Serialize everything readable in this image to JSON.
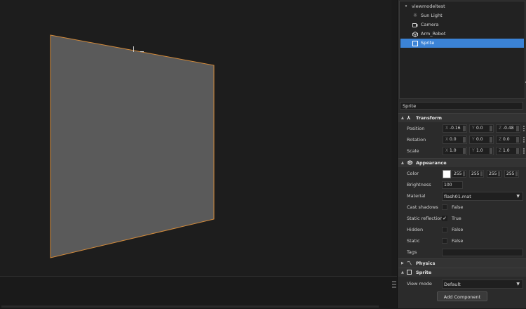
{
  "hierarchy": {
    "root": "viewmodeltest",
    "items": [
      {
        "label": "Sun Light",
        "icon": "sun-icon"
      },
      {
        "label": "Camera",
        "icon": "camera-icon"
      },
      {
        "label": "Arm_Robot",
        "icon": "model-icon"
      },
      {
        "label": "Sprite",
        "icon": "sprite-icon",
        "selected": true
      }
    ]
  },
  "object_name": "Sprite",
  "transform": {
    "title": "Transform",
    "position_label": "Position",
    "rotation_label": "Rotation",
    "scale_label": "Scale",
    "position": {
      "x": "-0.16",
      "y": "0.0",
      "z": "-0.48"
    },
    "rotation": {
      "x": "0.0",
      "y": "0.0",
      "z": "0.0"
    },
    "scale": {
      "x": "1.0",
      "y": "1.0",
      "z": "1.0"
    },
    "axis_x": "X",
    "axis_y": "Y",
    "axis_z": "Z"
  },
  "appearance": {
    "title": "Appearance",
    "color_label": "Color",
    "color_values": [
      "255",
      "255",
      "255",
      "255"
    ],
    "color_swatch": "#ffffff",
    "brightness_label": "Brightness",
    "brightness": "100",
    "material_label": "Material",
    "material": "flash01.mat",
    "cast_shadows_label": "Cast shadows",
    "cast_shadows": "False",
    "static_reflection_label": "Static reflection",
    "static_reflection": "True",
    "hidden_label": "Hidden",
    "hidden": "False",
    "static_label": "Static",
    "static": "False",
    "tags_label": "Tags",
    "tags": ""
  },
  "physics": {
    "title": "Physics"
  },
  "sprite": {
    "title": "Sprite",
    "view_mode_label": "View mode",
    "view_mode": "Default"
  },
  "add_component": "Add Component",
  "colors": {
    "selection": "#3b83d6",
    "sprite_outline": "#d38a3a",
    "sprite_fill": "#5a5a5a"
  }
}
